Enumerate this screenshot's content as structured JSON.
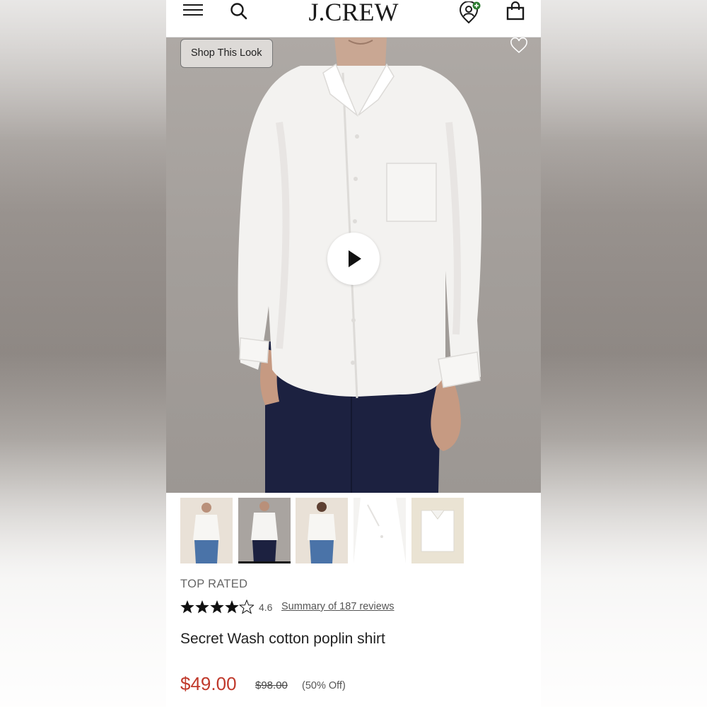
{
  "header": {
    "logo": "J.CREW",
    "icons": [
      "menu-icon",
      "search-icon",
      "account-icon",
      "bag-icon"
    ],
    "account_badge_color": "#2e7d32"
  },
  "hero": {
    "shop_look_label": "Shop This Look",
    "icons": [
      "heart-icon",
      "play-icon"
    ]
  },
  "thumbnails": {
    "count": 5,
    "active_index": 1
  },
  "product": {
    "badge": "TOP RATED",
    "rating": "4.6",
    "stars": 4.6,
    "reviews_link": "Summary of 187 reviews",
    "title": "Secret Wash cotton poplin shirt",
    "sale_price": "$49.00",
    "original_price": "$98.00",
    "discount": "(50% Off)",
    "sale_color": "#c0392b"
  }
}
